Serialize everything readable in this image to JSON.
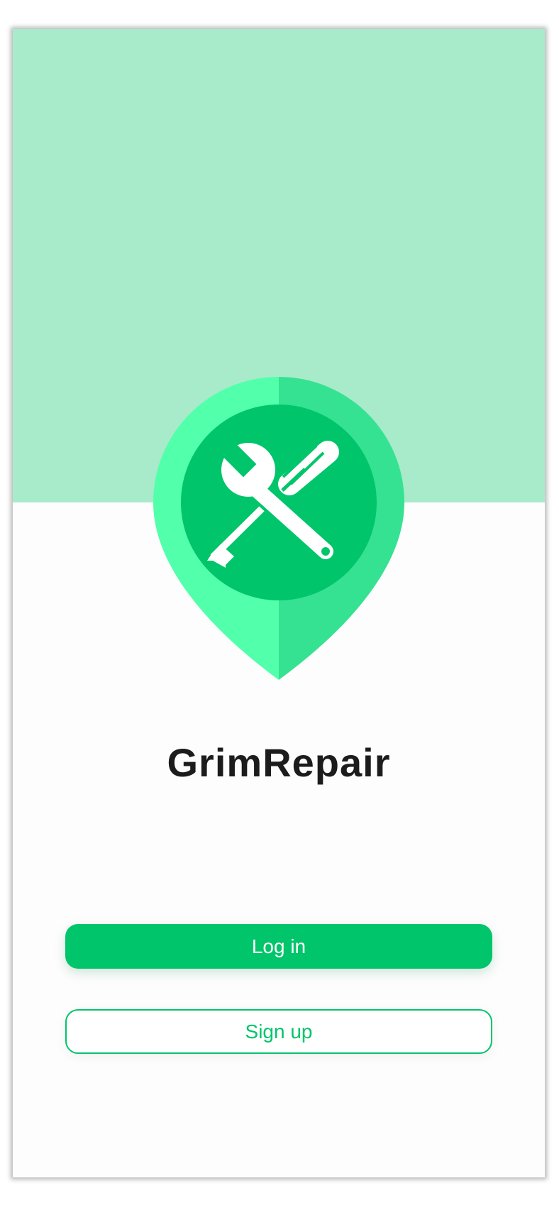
{
  "app": {
    "name": "GrimRepair",
    "logo_icon": "tools-pin-icon"
  },
  "colors": {
    "header_bg": "#a7ebcb",
    "pin_light": "#52ffaa",
    "pin_dark": "#35e291",
    "accent": "#00c56a"
  },
  "actions": {
    "login_label": "Log in",
    "signup_label": "Sign up"
  }
}
